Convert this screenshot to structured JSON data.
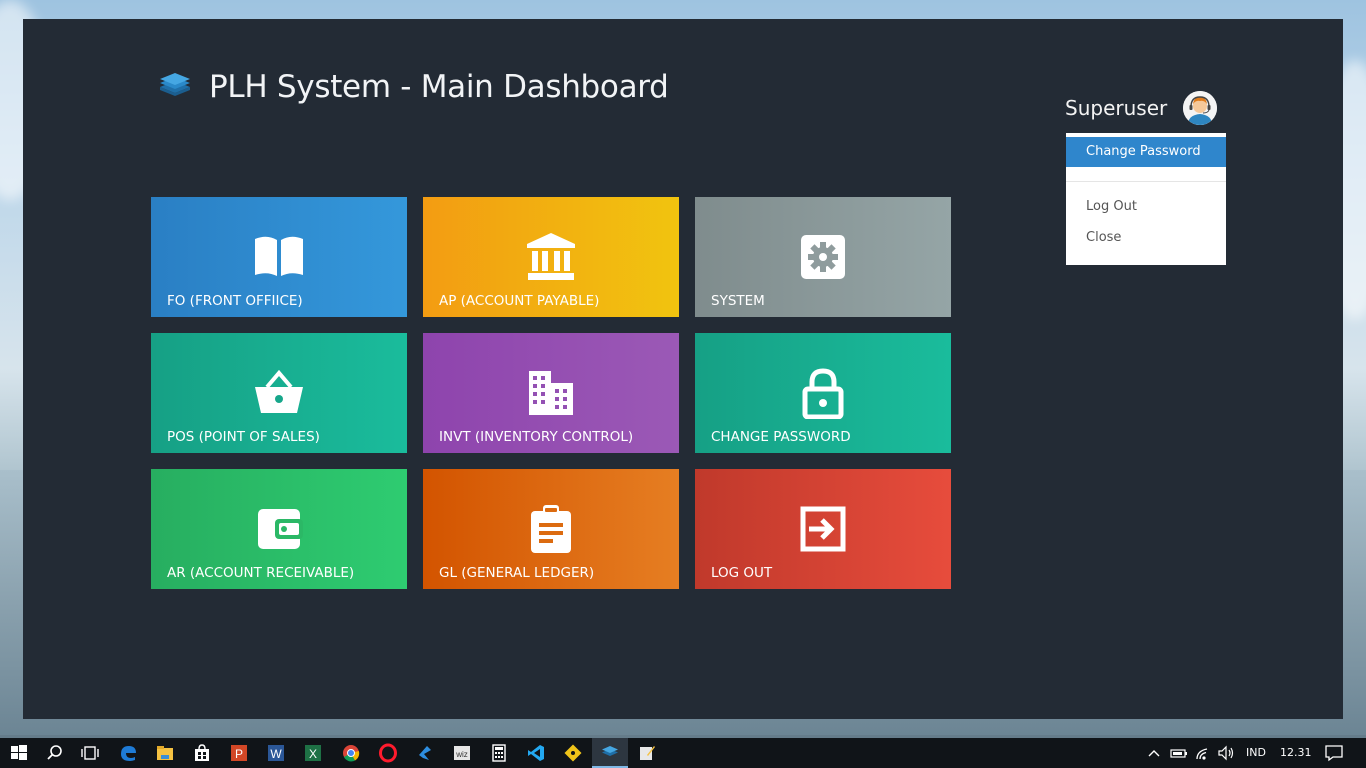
{
  "window": {
    "title": "PLH System - Main Dashboard"
  },
  "user": {
    "name": "Superuser",
    "menu": {
      "change_password": "Change Password",
      "log_out": "Log Out",
      "close": "Close"
    }
  },
  "tiles": [
    {
      "label": "FO (FRONT OFFIICE)",
      "icon": "book-open-icon",
      "color_from": "#2a7fc4",
      "color_to": "#3498db"
    },
    {
      "label": "AP (ACCOUNT PAYABLE)",
      "icon": "bank-icon",
      "color_from": "#f39c12",
      "color_to": "#f1c40f"
    },
    {
      "label": "SYSTEM",
      "icon": "gear-icon",
      "color_from": "#7f8c8d",
      "color_to": "#95a5a6"
    },
    {
      "label": "POS (POINT OF SALES)",
      "icon": "basket-icon",
      "color_from": "#16a085",
      "color_to": "#1abc9c"
    },
    {
      "label": "INVT (INVENTORY CONTROL)",
      "icon": "building-icon",
      "color_from": "#8e44ad",
      "color_to": "#9b59b6"
    },
    {
      "label": "CHANGE PASSWORD",
      "icon": "lock-icon",
      "color_from": "#16a085",
      "color_to": "#1abc9c"
    },
    {
      "label": "AR (ACCOUNT RECEIVABLE)",
      "icon": "wallet-icon",
      "color_from": "#27ae60",
      "color_to": "#2ecc71"
    },
    {
      "label": "GL (GENERAL LEDGER)",
      "icon": "clipboard-icon",
      "color_from": "#d35400",
      "color_to": "#e67e22"
    },
    {
      "label": "LOG OUT",
      "icon": "sign-out-icon",
      "color_from": "#c0392b",
      "color_to": "#e74c3c"
    }
  ],
  "taskbar": {
    "language": "IND",
    "time": "12.31",
    "apps": [
      "windows-start-icon",
      "search-icon",
      "task-view-icon",
      "edge-icon",
      "file-explorer-icon",
      "store-icon",
      "powerpoint-icon",
      "word-icon",
      "excel-icon",
      "chrome-icon",
      "opera-icon",
      "app-blue-icon",
      "app-wiz-icon",
      "calculator-icon",
      "vscode-icon",
      "git-icon",
      "plh-system-icon",
      "notepad-icon"
    ]
  },
  "colors": {
    "app_background": "#232b35",
    "dropdown_active": "#2f86cc"
  }
}
